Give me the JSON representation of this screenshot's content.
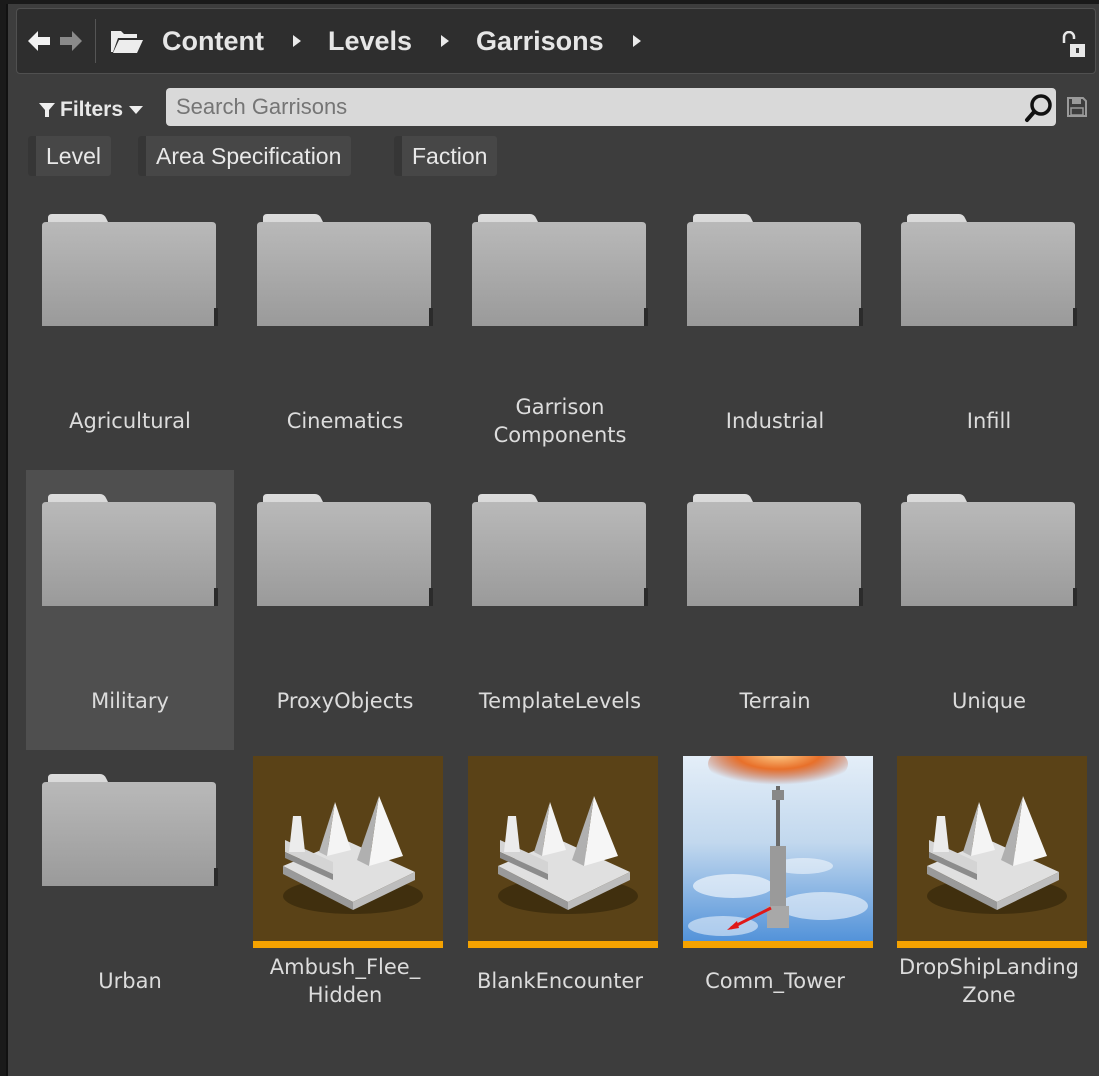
{
  "breadcrumb": {
    "items": [
      "Content",
      "Levels",
      "Garrisons"
    ]
  },
  "filters": {
    "label": "Filters",
    "search_placeholder": "Search Garrisons",
    "chips": [
      "Level",
      "Area Specification",
      "Faction"
    ]
  },
  "folders": [
    {
      "label": "Agricultural"
    },
    {
      "label": "Cinematics"
    },
    {
      "label": "Garrison\nComponents"
    },
    {
      "label": "Industrial"
    },
    {
      "label": "Infill"
    },
    {
      "label": "Military",
      "selected": true
    },
    {
      "label": "ProxyObjects"
    },
    {
      "label": "TemplateLevels"
    },
    {
      "label": "Terrain"
    },
    {
      "label": "Unique"
    },
    {
      "label": "Urban"
    }
  ],
  "levels": [
    {
      "label": "Ambush_Flee_\nHidden",
      "thumbnail": "level-icon"
    },
    {
      "label": "BlankEncounter",
      "thumbnail": "level-icon"
    },
    {
      "label": "Comm_Tower",
      "thumbnail": "tower-screenshot"
    },
    {
      "label": "DropShipLanding\nZone",
      "thumbnail": "level-icon"
    }
  ],
  "colors": {
    "panel_bg": "#3d3d3d",
    "selected_tile": "#4f4f4f",
    "level_thumb_bg": "#5a4217",
    "level_accent": "#f5a200",
    "search_bg": "#d9d9d9"
  }
}
